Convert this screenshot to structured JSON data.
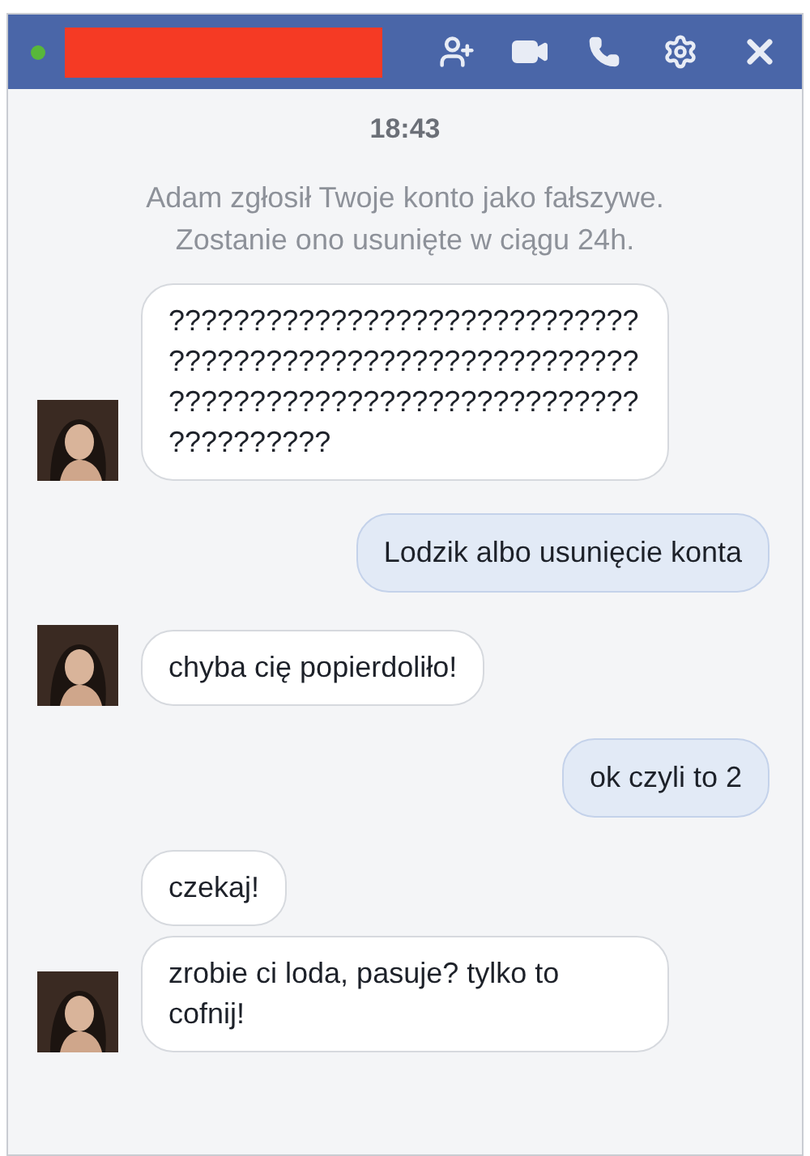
{
  "header": {
    "online": true,
    "name_redacted": true
  },
  "time": "18:43",
  "notice": "Adam zgłosił Twoje konto jako fałszywe. Zostanie ono usunięte w ciągu 24h.",
  "groups": [
    {
      "kind": "incoming",
      "bubbles": [
        {
          "text": "?????????????????????????????????????????????????????????????????????????????????????????????????"
        }
      ]
    },
    {
      "kind": "outgoing",
      "bubbles": [
        {
          "text": "Lodzik albo usunięcie konta"
        }
      ]
    },
    {
      "kind": "incoming",
      "bubbles": [
        {
          "text": "chyba cię popierdoliło!"
        }
      ]
    },
    {
      "kind": "outgoing",
      "bubbles": [
        {
          "text": "ok czyli to 2"
        }
      ]
    },
    {
      "kind": "incoming",
      "bubbles": [
        {
          "text": "czekaj!"
        },
        {
          "text": "zrobie ci loda, pasuje? tylko to cofnij!"
        }
      ]
    }
  ]
}
